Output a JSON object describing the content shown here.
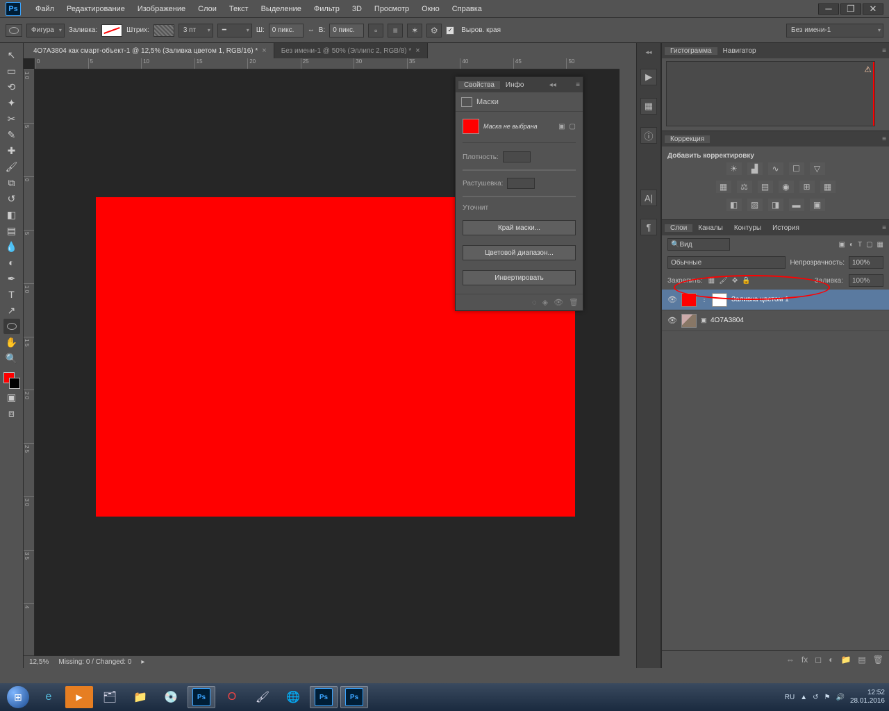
{
  "menu": [
    "Файл",
    "Редактирование",
    "Изображение",
    "Слои",
    "Текст",
    "Выделение",
    "Фильтр",
    "3D",
    "Просмотр",
    "Окно",
    "Справка"
  ],
  "options": {
    "shape": "Фигура",
    "fill": "Заливка:",
    "stroke": "Штрих:",
    "strokeW": "3 пт",
    "w": "Ш:",
    "wval": "0 пикс.",
    "h": "В:",
    "hval": "0 пикс.",
    "edge": "Выров. края",
    "docsel": "Без имени-1"
  },
  "tabs": [
    {
      "title": "4O7A3804 как смарт-объект-1 @ 12,5% (Заливка цветом 1, RGB/16) *",
      "active": true
    },
    {
      "title": "Без имени-1 @ 50% (Эллипс 2, RGB/8) *",
      "active": false
    }
  ],
  "zoom": "12,5%",
  "status": "Missing: 0 / Changed: 0",
  "propPanel": {
    "tabs": [
      "Свойства",
      "Инфо"
    ],
    "head": "Маски",
    "nomask": "Маска не выбрана",
    "density": "Плотность:",
    "feather": "Растушевка:",
    "refine": "Уточнит",
    "b1": "Край маски...",
    "b2": "Цветовой диапазон...",
    "b3": "Инвертировать"
  },
  "histo": {
    "tabs": [
      "Гистограмма",
      "Навигатор"
    ]
  },
  "corr": {
    "tab": "Коррекция",
    "add": "Добавить корректировку"
  },
  "layers": {
    "tabs": [
      "Слои",
      "Каналы",
      "Контуры",
      "История"
    ],
    "kind": "Вид",
    "mode": "Обычные",
    "opacity": "Непрозрачность:",
    "opv": "100%",
    "lock": "Закрепить:",
    "fill": "Заливка:",
    "fillv": "100%",
    "items": [
      {
        "name": "Заливка цветом 1",
        "selected": true,
        "fill": "red"
      },
      {
        "name": "4O7A3804",
        "selected": false,
        "fill": "img"
      }
    ]
  },
  "taskbar": {
    "lang": "RU",
    "time": "12:52",
    "date": "28.01.2016"
  }
}
